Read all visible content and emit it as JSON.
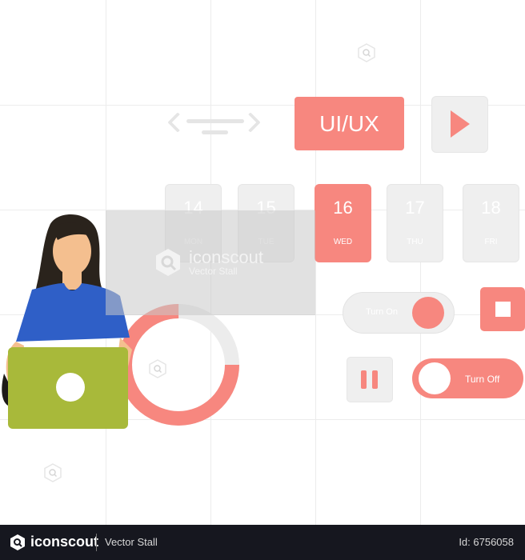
{
  "colors": {
    "accent": "#f7877f",
    "neutral": "#efefef",
    "laptop": "#a8b93a",
    "shirt": "#2f5fc7",
    "hair": "#2a231c",
    "skin": "#f4bf8f",
    "footer_bg": "#16171f"
  },
  "nav": {
    "prev_icon": "chevron-left-icon",
    "next_icon": "chevron-right-icon"
  },
  "tag_button": {
    "label": "UI/UX"
  },
  "play_button": {
    "icon": "play-icon"
  },
  "calendar": {
    "days": [
      {
        "num": "14",
        "dow": "MON",
        "active": false
      },
      {
        "num": "15",
        "dow": "TUE",
        "active": false
      },
      {
        "num": "16",
        "dow": "WED",
        "active": true
      },
      {
        "num": "17",
        "dow": "THU",
        "active": false
      },
      {
        "num": "18",
        "dow": "FRI",
        "active": false
      }
    ]
  },
  "toggle_on": {
    "label": "Turn On",
    "state": "on"
  },
  "toggle_off": {
    "label": "Turn Off",
    "state": "off"
  },
  "stop_button": {
    "icon": "stop-icon"
  },
  "pause_button": {
    "icon": "pause-icon"
  },
  "progress_ring": {
    "filled_fraction": 0.75
  },
  "watermark": {
    "brand": "iconscout",
    "author": "Vector Stall"
  },
  "footer": {
    "brand": "iconscout",
    "author": "Vector Stall",
    "id": "Id: 6756058"
  }
}
